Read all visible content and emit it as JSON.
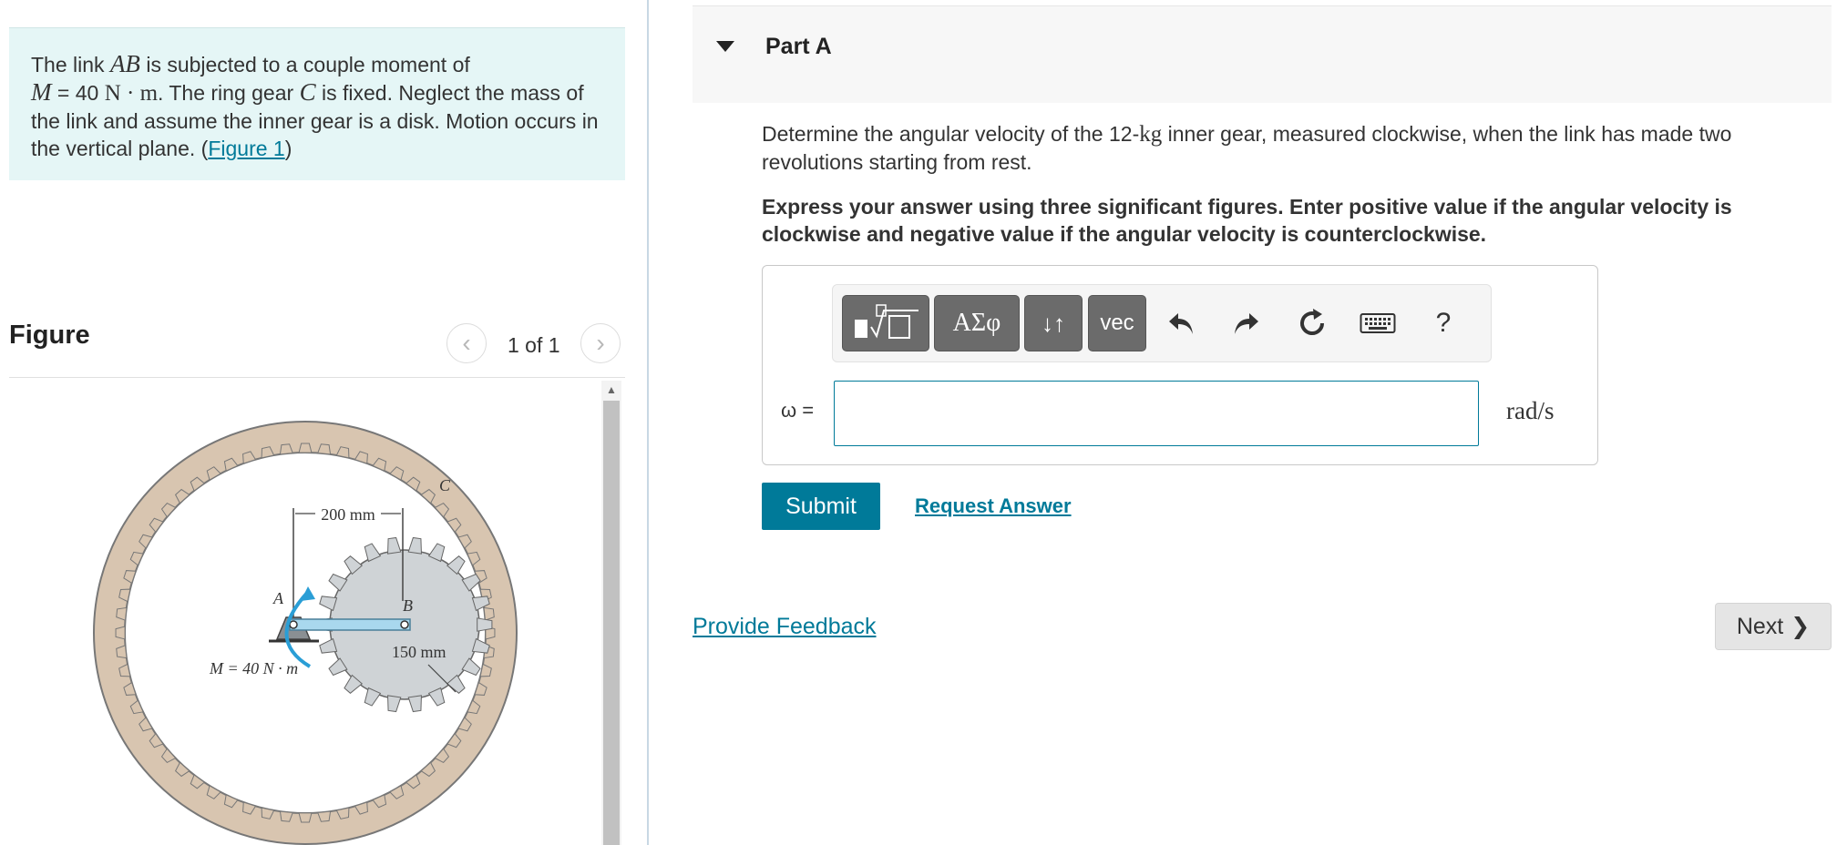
{
  "problem": {
    "text_1": "The link ",
    "link_name": "AB",
    "text_2": " is subjected to a couple moment of",
    "moment_symbol": "M",
    "moment_eq": " = 40 ",
    "moment_unit": "N · m",
    "text_3": ". The ring gear ",
    "gear_name": "C",
    "text_4": " is fixed. Neglect the mass of the link and assume the inner gear is a disk. Motion occurs in the vertical plane. (",
    "figure_link": "Figure 1",
    "text_5": ")"
  },
  "figure": {
    "title": "Figure",
    "counter": "1 of 1",
    "labels": {
      "dim_200": "200 mm",
      "dim_150": "150 mm",
      "point_a": "A",
      "point_b": "B",
      "point_c": "C",
      "moment": "M = 40 N · m"
    }
  },
  "part": {
    "title": "Part A",
    "question_1": "Determine the angular velocity of the 12-",
    "question_kg": "kg",
    "question_2": " inner gear, measured clockwise, when the link has made two revolutions starting from rest.",
    "instruction": "Express your answer using three significant figures. Enter positive value if the angular velocity is clockwise and negative value if the angular velocity is counterclockwise."
  },
  "toolbar": {
    "greek": "ΑΣφ",
    "subsup": "↓↑",
    "vec": "vec",
    "help": "?"
  },
  "answer": {
    "variable": "ω =",
    "value": "",
    "unit": "rad/s"
  },
  "actions": {
    "submit": "Submit",
    "request_answer": "Request Answer",
    "provide_feedback": "Provide Feedback",
    "next": "Next"
  },
  "colors": {
    "accent": "#007a99",
    "problem_bg": "#e5f6f6",
    "ring_gear": "#d8c5b0",
    "inner_gear": "#cfd3d6",
    "link": "#a9d8ee"
  }
}
